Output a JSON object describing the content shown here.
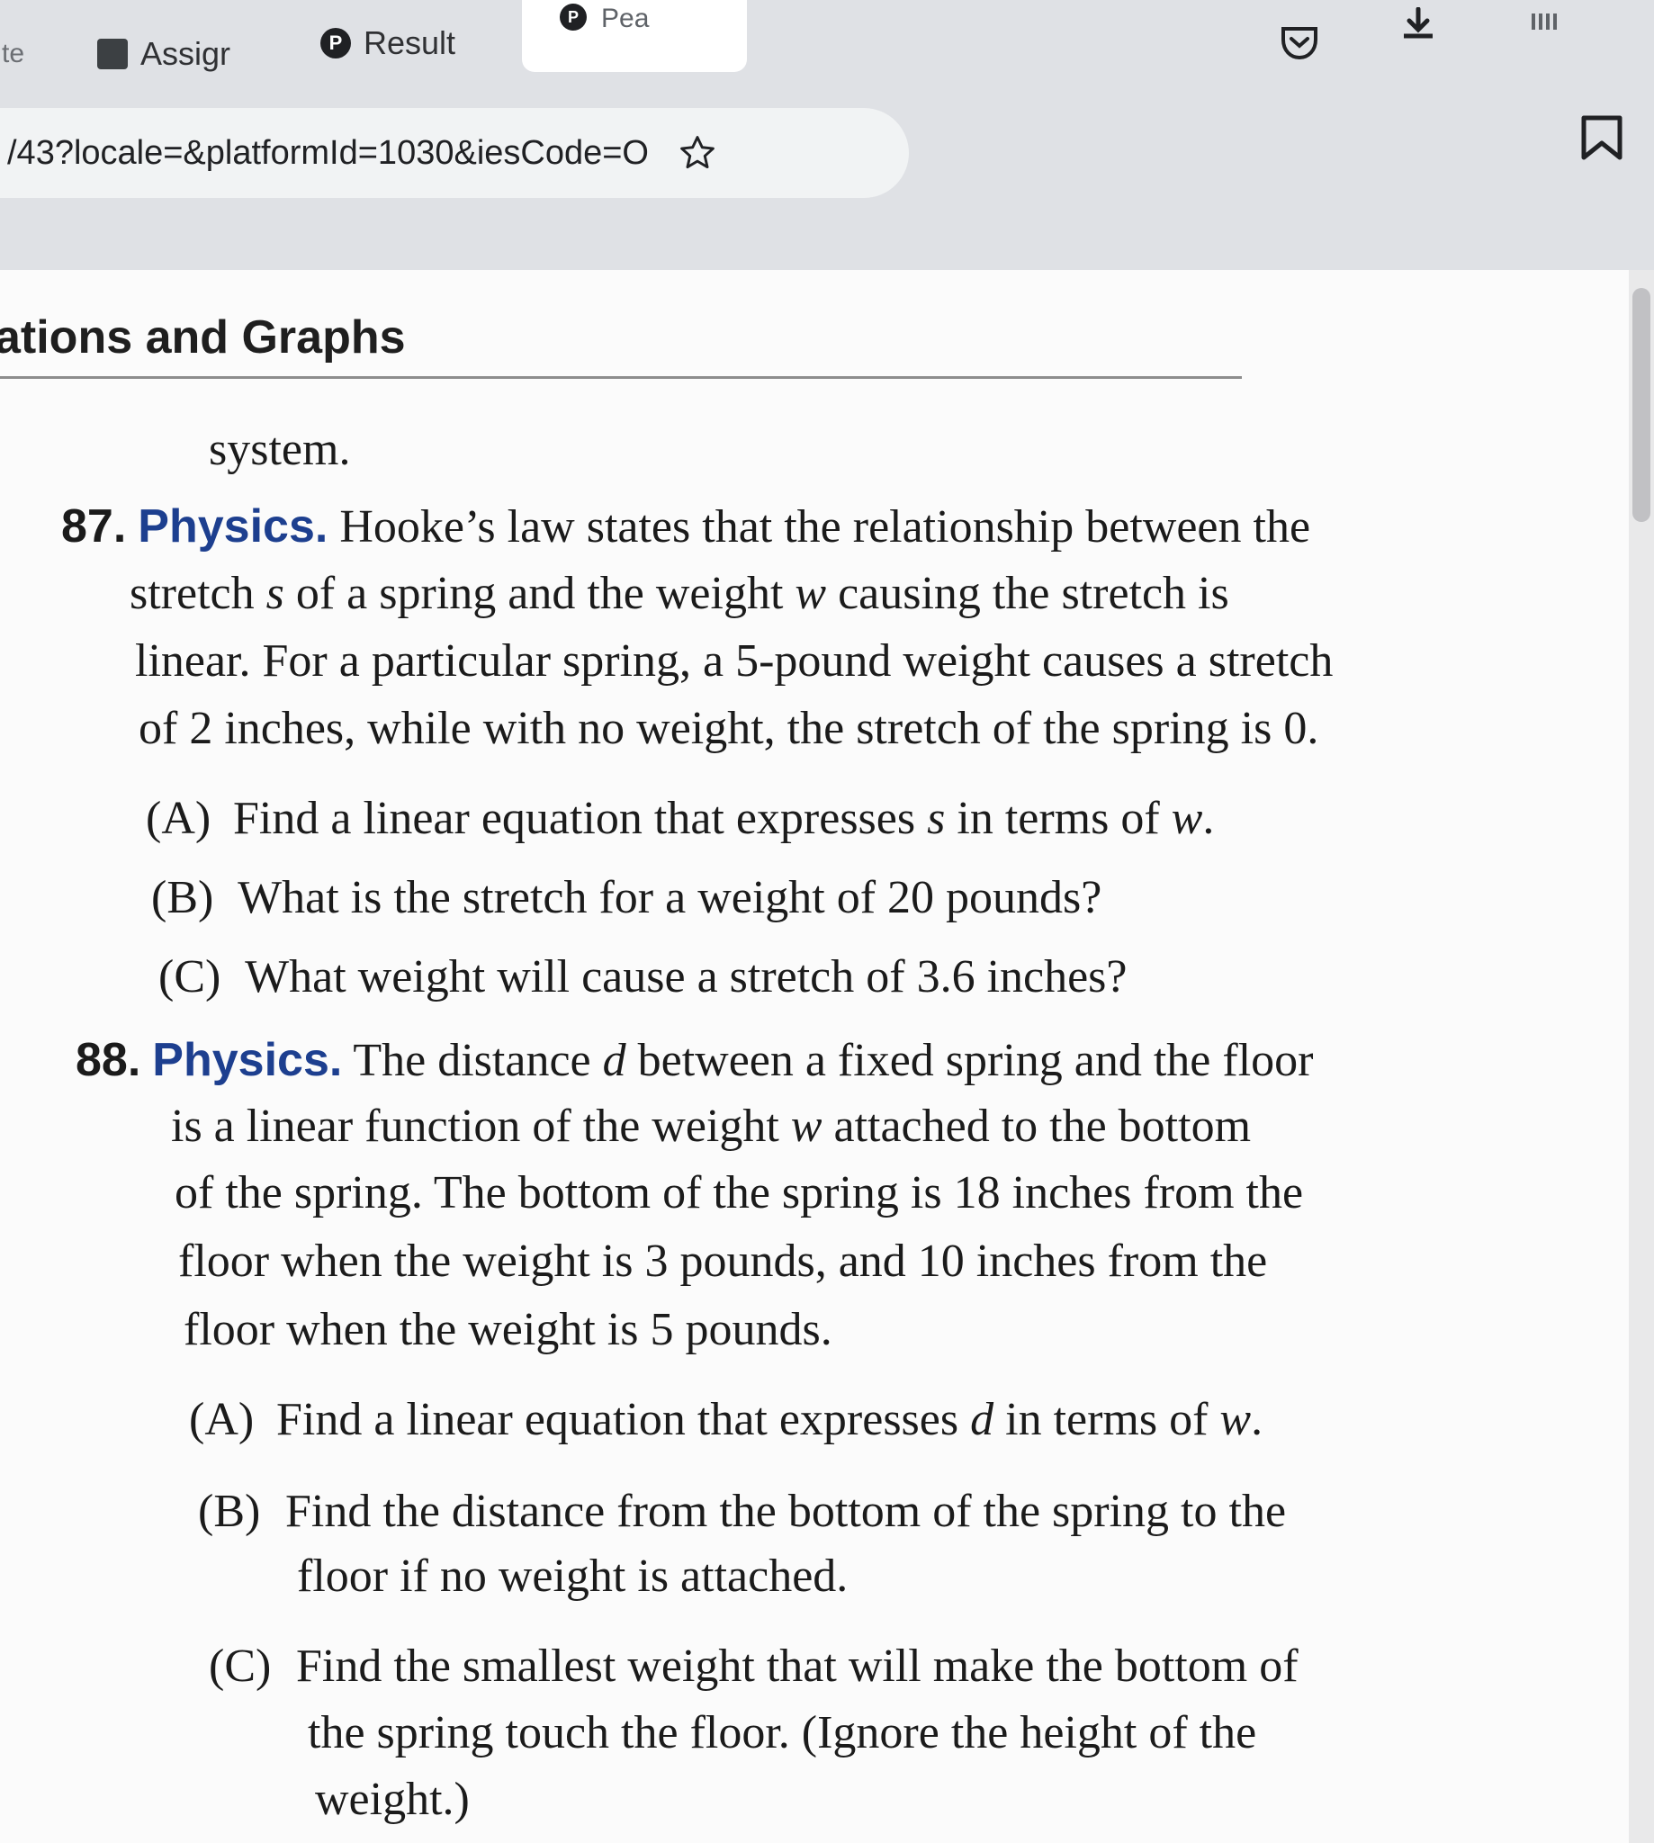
{
  "browser": {
    "tabs": [
      {
        "label": "te"
      },
      {
        "label": "Assigr"
      },
      {
        "label": "Result"
      },
      {
        "label": "Pea"
      }
    ],
    "url": "/43?locale=&platformId=1030&iesCode=O"
  },
  "page": {
    "chapter_title": "ations and Graphs",
    "prev_fragment": "system.",
    "problems": [
      {
        "number": "87.",
        "heading": "Physics.",
        "lines": [
          "Hooke’s law states that the relationship between the",
          "stretch ",
          "of a spring and the weight ",
          "causing the stretch is",
          "linear. For a particular spring, a 5-pound weight causes a stretch",
          "of 2 inches, while with no weight, the stretch of the spring is 0."
        ],
        "vars": [
          "s",
          "w"
        ],
        "parts": [
          {
            "label": "(A)",
            "text_a": "Find a linear equation that expresses ",
            "var_a": "s",
            "text_b": " in terms of ",
            "var_b": "w",
            "text_c": "."
          },
          {
            "label": "(B)",
            "text": "What is the stretch for a weight of 20 pounds?"
          },
          {
            "label": "(C)",
            "text": "What weight will cause a stretch of 3.6 inches?"
          }
        ]
      },
      {
        "number": "88.",
        "heading": "Physics.",
        "line1_a": "The distance ",
        "var_d": "d",
        "line1_b": " between a fixed spring and the floor",
        "line2_a": "is a linear function of the weight ",
        "var_w": "w",
        "line2_b": " attached to the bottom",
        "line3": "of the spring. The bottom of the spring is 18 inches from the",
        "line4": "floor when the weight is 3 pounds, and 10 inches from the",
        "line5": "floor when the weight is 5 pounds.",
        "parts": [
          {
            "label": "(A)",
            "text_a": "Find a linear equation that expresses ",
            "var_a": "d",
            "text_b": " in terms of ",
            "var_b": "w",
            "text_c": "."
          },
          {
            "label": "(B)",
            "line1": "Find the distance from the bottom of the spring to the",
            "line2": "floor if no weight is attached."
          },
          {
            "label": "(C)",
            "line1": "Find the smallest weight that will make the bottom of",
            "line2": "the spring touch the floor. (Ignore the height of the",
            "line3": "weight.)"
          }
        ]
      }
    ]
  }
}
